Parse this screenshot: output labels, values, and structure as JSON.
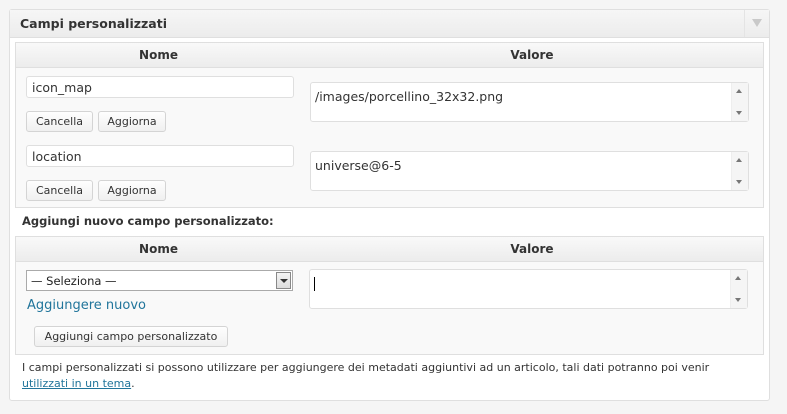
{
  "box": {
    "title": "Campi personalizzati",
    "toggle_icon": "triangle-down-icon"
  },
  "existing": {
    "header": {
      "name": "Nome",
      "value": "Valore"
    },
    "rows": [
      {
        "key": "icon_map",
        "value": "/images/porcellino_32x32.png",
        "delete_label": "Cancella",
        "update_label": "Aggiorna"
      },
      {
        "key": "location",
        "value": "universe@6-5",
        "delete_label": "Cancella",
        "update_label": "Aggiorna"
      }
    ]
  },
  "new_field": {
    "label": "Aggiungi nuovo campo personalizzato:",
    "header": {
      "name": "Nome",
      "value": "Valore"
    },
    "select_value": "— Seleziona —",
    "add_new_link": "Aggiungere nuovo",
    "value_text": "",
    "submit_label": "Aggiungi campo personalizzato"
  },
  "help": {
    "text": "I campi personalizzati si possono utilizzare per aggiungere dei metadati aggiuntivi ad un articolo, tali dati potranno poi venir ",
    "link": "utilizzati in un tema",
    "suffix": "."
  },
  "colors": {
    "link": "#21759b",
    "border": "#dfdfdf"
  }
}
